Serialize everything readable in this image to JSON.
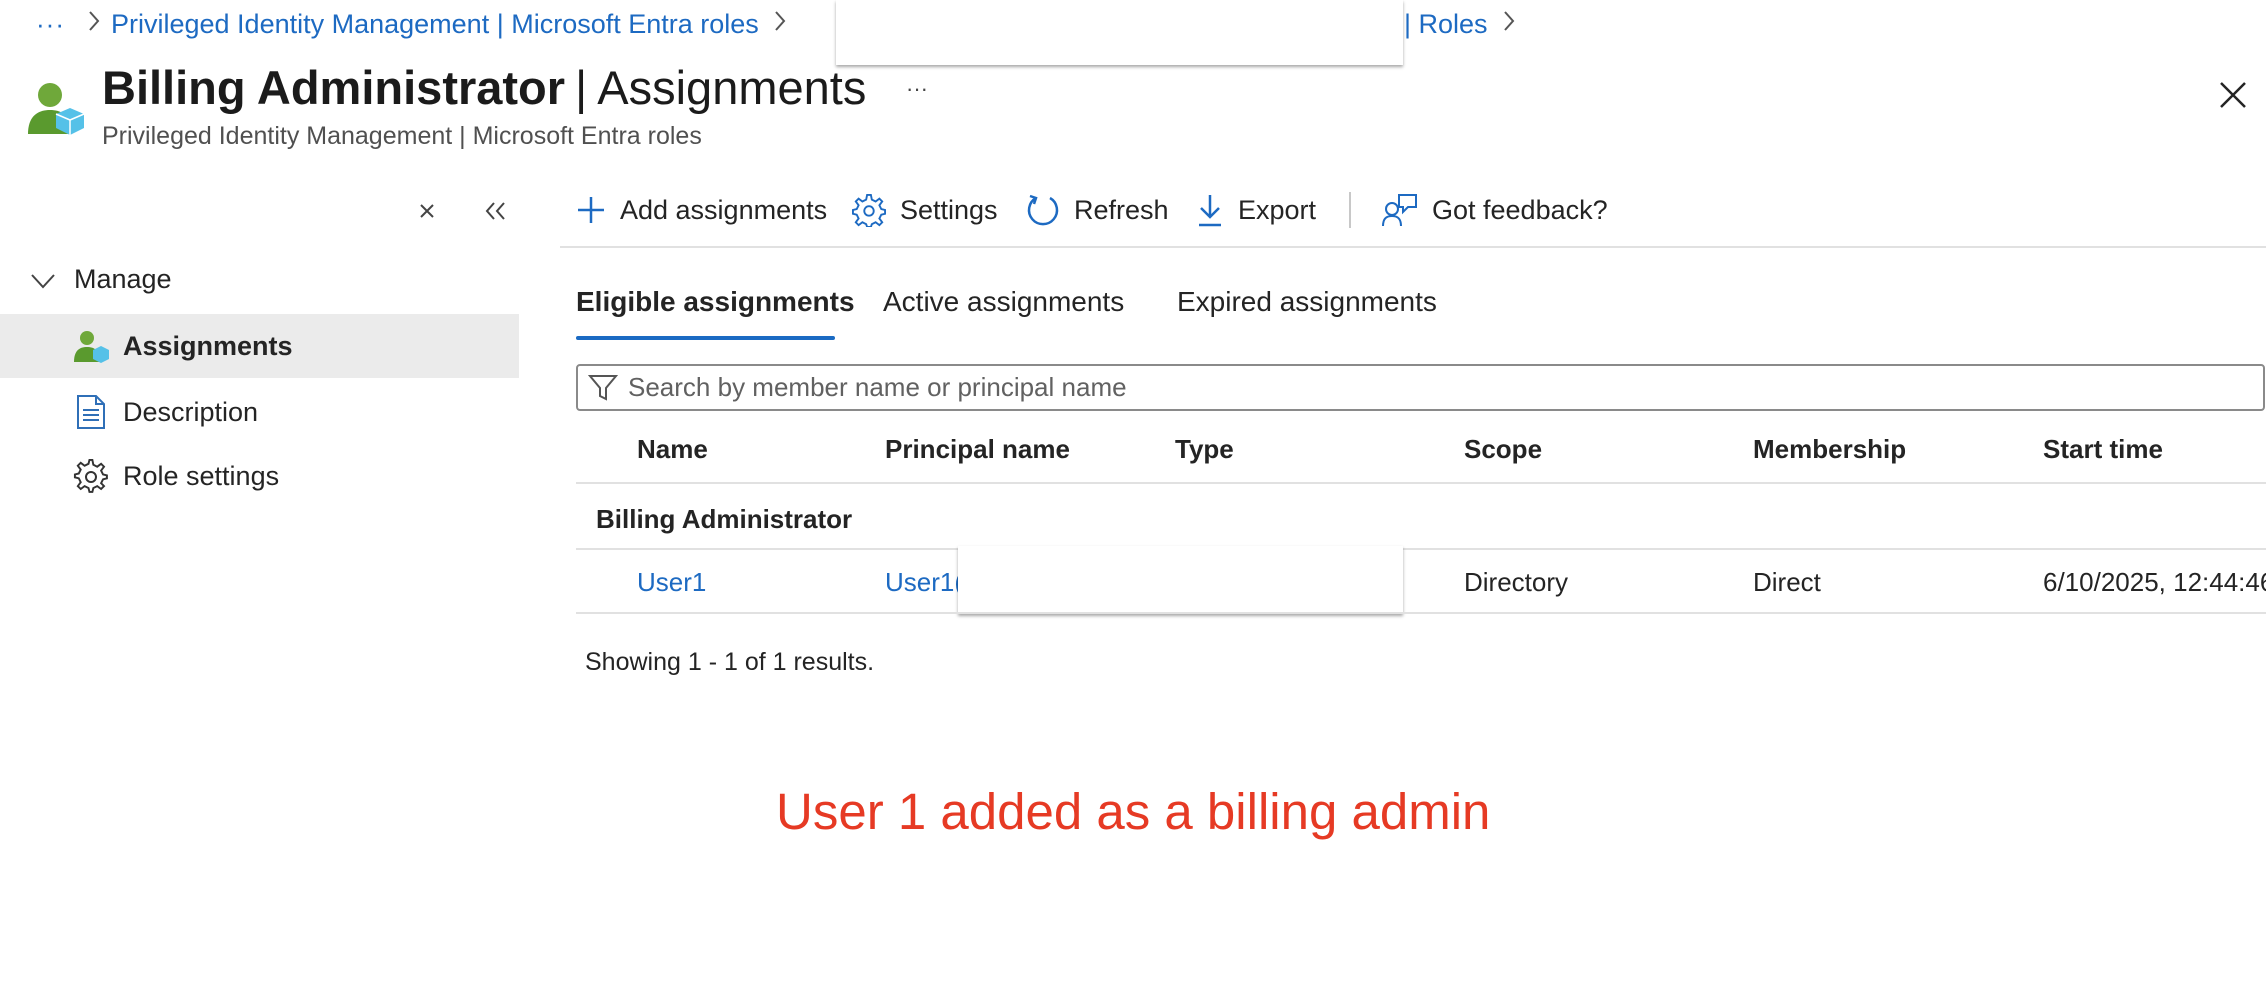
{
  "breadcrumb": {
    "ellipsis": "···",
    "link1": "Privileged Identity Management | Microsoft Entra roles",
    "link2": "| Roles"
  },
  "header": {
    "role_name": "Billing Administrator",
    "separator": "|",
    "blade_name": "Assignments",
    "more": "···",
    "subtitle": "Privileged Identity Management | Microsoft Entra roles"
  },
  "sidebar": {
    "group_label": "Manage",
    "items": [
      {
        "label": "Assignments",
        "icon": "user-role-icon",
        "active": true
      },
      {
        "label": "Description",
        "icon": "document-icon",
        "active": false
      },
      {
        "label": "Role settings",
        "icon": "gear-icon",
        "active": false
      }
    ]
  },
  "toolbar": {
    "add": "Add assignments",
    "settings": "Settings",
    "refresh": "Refresh",
    "export": "Export",
    "feedback": "Got feedback?"
  },
  "tabs": [
    "Eligible assignments",
    "Active assignments",
    "Expired assignments"
  ],
  "search": {
    "placeholder": "Search by member name or principal name"
  },
  "table": {
    "columns": [
      "Name",
      "Principal name",
      "Type",
      "Scope",
      "Membership",
      "Start time"
    ],
    "group": "Billing Administrator",
    "rows": [
      {
        "name": "User1",
        "principal": "User1(",
        "type": "",
        "scope": "Directory",
        "membership": "Direct",
        "start": "6/10/2025, 12:44:46"
      }
    ],
    "footer": "Showing 1 - 1 of 1 results."
  },
  "annotation": "User 1 added as a billing admin",
  "colors": {
    "link": "#1d6ac2",
    "annotation": "#e63a24",
    "accent": "#1a6ac3"
  }
}
